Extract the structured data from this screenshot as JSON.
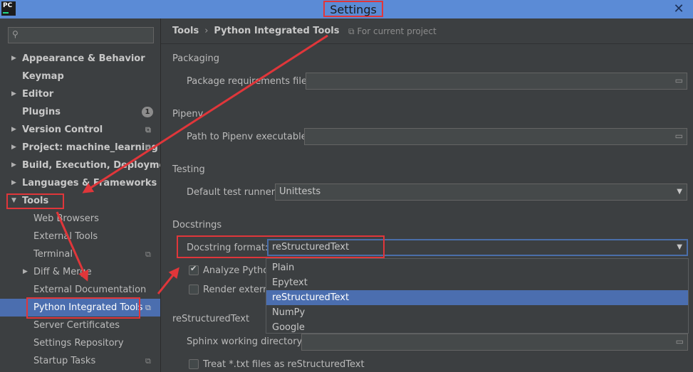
{
  "window": {
    "title": "Settings",
    "close_glyph": "✕"
  },
  "sidebar": {
    "search_placeholder": "",
    "items": [
      {
        "label": "Appearance & Behavior"
      },
      {
        "label": "Keymap"
      },
      {
        "label": "Editor"
      },
      {
        "label": "Plugins",
        "badge": "1"
      },
      {
        "label": "Version Control"
      },
      {
        "label": "Project: machine_learning"
      },
      {
        "label": "Build, Execution, Deployment"
      },
      {
        "label": "Languages & Frameworks"
      },
      {
        "label": "Tools"
      },
      {
        "label": "Web Browsers"
      },
      {
        "label": "External Tools"
      },
      {
        "label": "Terminal"
      },
      {
        "label": "Diff & Merge"
      },
      {
        "label": "External Documentation"
      },
      {
        "label": "Python Integrated Tools"
      },
      {
        "label": "Server Certificates"
      },
      {
        "label": "Settings Repository"
      },
      {
        "label": "Startup Tasks"
      }
    ]
  },
  "main": {
    "breadcrumb": [
      "Tools",
      "Python Integrated Tools"
    ],
    "for_project": "For current project",
    "packaging": {
      "title": "Packaging",
      "req_label": "Package requirements file:",
      "req_value": ""
    },
    "pipenv": {
      "title": "Pipenv",
      "path_label": "Path to Pipenv executable:",
      "path_value": ""
    },
    "testing": {
      "title": "Testing",
      "runner_label": "Default test runner:",
      "runner_value": "Unittests"
    },
    "docstrings": {
      "title": "Docstrings",
      "format_label": "Docstring format:",
      "format_value": "reStructuredText",
      "analyze_label": "Analyze Python",
      "analyze_checked": true,
      "render_label": "Render externa",
      "render_checked": false,
      "options": [
        "Plain",
        "Epytext",
        "reStructuredText",
        "NumPy",
        "Google"
      ],
      "selected_option": "reStructuredText"
    },
    "rst": {
      "title": "reStructuredText",
      "sphinx_label": "Sphinx working directory:",
      "sphinx_value": "",
      "treat_label": "Treat *.txt files as reStructuredText",
      "treat_checked": false
    }
  },
  "icons": {
    "search": "search-icon",
    "folder": "folder-icon",
    "caret": "chevron-down-icon",
    "expand": "chevron-right-icon",
    "collapse": "triangle-down-icon",
    "project": "project-scope-icon"
  },
  "colors": {
    "titlebar": "#5b8bd6",
    "selection": "#4b6eaf",
    "annotation": "#e0363a",
    "background": "#3c3f41"
  }
}
